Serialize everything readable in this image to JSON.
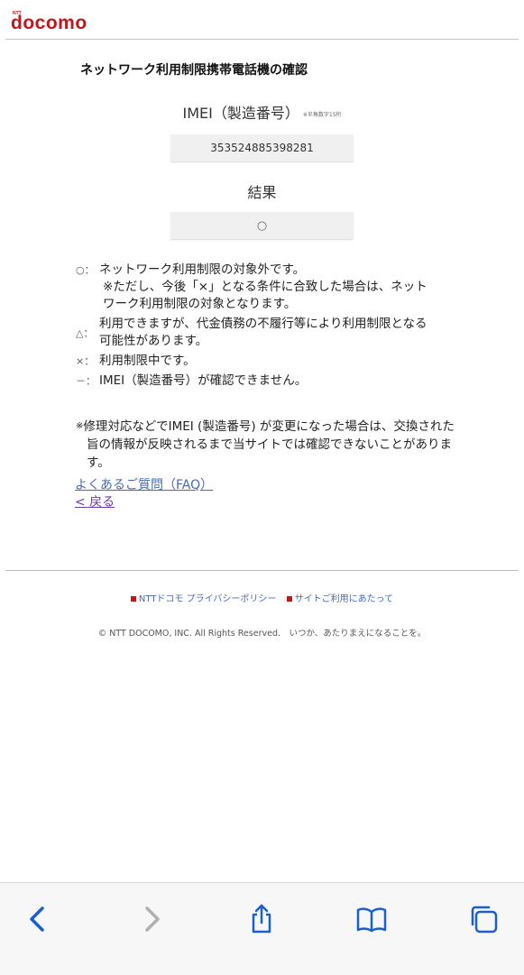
{
  "header": {
    "logo_top": "NTT",
    "logo": "docomo"
  },
  "page_title": "ネットワーク利用制限携帯電話機の確認",
  "imei": {
    "label": "IMEI（製造番号）",
    "note": "※半角数字15桁",
    "value": "353524885398281"
  },
  "result": {
    "label": "結果",
    "value": "○"
  },
  "legend": [
    {
      "symbol": "○：",
      "lines": [
        "ネットワーク利用制限の対象外です。",
        "※ただし、今後「×」となる条件に合致した場合は、ネット",
        "ワーク利用制限の対象となります。"
      ]
    },
    {
      "symbol": "△：",
      "lines": [
        "利用できますが、代金債務の不履行等により利用制限となる",
        "可能性があります。"
      ]
    },
    {
      "symbol": "×：",
      "lines": [
        "利用制限中です。"
      ]
    },
    {
      "symbol": "－：",
      "lines": [
        "IMEI（製造番号）が確認できません。"
      ]
    }
  ],
  "note": {
    "mark": "※",
    "text": "修理対応などでIMEI (製造番号) が変更になった場合は、交換された旨の情報が反映されるまで当サイトでは確認できないことがあります。"
  },
  "links": {
    "faq": "よくあるご質問（FAQ）",
    "back": "< 戻る"
  },
  "footer": {
    "privacy": "NTTドコモ プライバシーポリシー",
    "terms": "サイトご利用にあたって",
    "copyright": "© NTT DOCOMO, INC. All Rights Reserved.　いつか、あたりまえになることを。"
  },
  "colors": {
    "brand": "#c0171c",
    "toolbar_icon": "#1a5fd0",
    "toolbar_icon_disabled": "#b0b0b0"
  },
  "toolbar_icons": [
    "back-chevron-icon",
    "forward-chevron-icon",
    "share-icon",
    "bookmarks-icon",
    "tabs-icon"
  ]
}
